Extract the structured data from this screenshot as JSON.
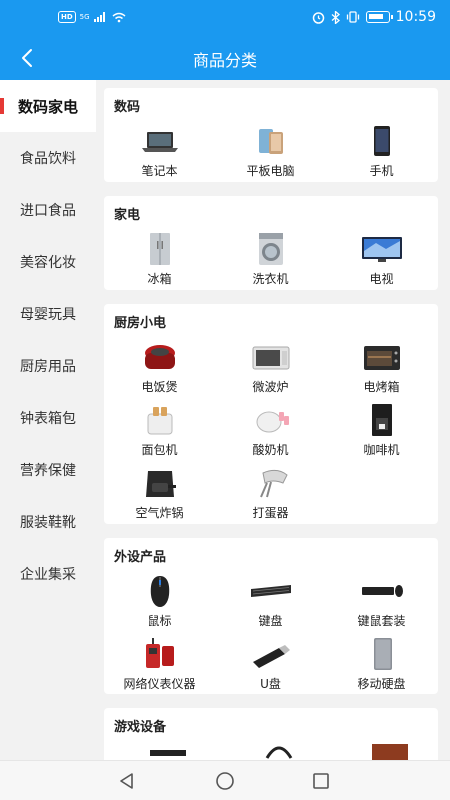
{
  "status": {
    "hd": "HD",
    "net": "5G",
    "time": "10:59",
    "battery": 0.85
  },
  "header": {
    "title": "商品分类"
  },
  "sidebar": {
    "items": [
      {
        "label": "数码家电",
        "active": true
      },
      {
        "label": "食品饮料"
      },
      {
        "label": "进口食品"
      },
      {
        "label": "美容化妆"
      },
      {
        "label": "母婴玩具"
      },
      {
        "label": "厨房用品"
      },
      {
        "label": "钟表箱包"
      },
      {
        "label": "营养保健"
      },
      {
        "label": "服装鞋靴"
      },
      {
        "label": "企业集采"
      }
    ]
  },
  "sections": [
    {
      "title": "数码",
      "items": [
        {
          "label": "笔记本",
          "icon": "laptop-icon"
        },
        {
          "label": "平板电脑",
          "icon": "tablet-icon"
        },
        {
          "label": "手机",
          "icon": "phone-icon"
        }
      ]
    },
    {
      "title": "家电",
      "items": [
        {
          "label": "冰箱",
          "icon": "fridge-icon"
        },
        {
          "label": "洗衣机",
          "icon": "washer-icon"
        },
        {
          "label": "电视",
          "icon": "tv-icon"
        }
      ]
    },
    {
      "title": "厨房小电",
      "items": [
        {
          "label": "电饭煲",
          "icon": "rice-cooker-icon"
        },
        {
          "label": "微波炉",
          "icon": "microwave-icon"
        },
        {
          "label": "电烤箱",
          "icon": "oven-icon"
        },
        {
          "label": "面包机",
          "icon": "toaster-icon"
        },
        {
          "label": "酸奶机",
          "icon": "yogurt-maker-icon"
        },
        {
          "label": "咖啡机",
          "icon": "coffee-machine-icon"
        },
        {
          "label": "空气炸锅",
          "icon": "air-fryer-icon"
        },
        {
          "label": "打蛋器",
          "icon": "mixer-icon"
        }
      ]
    },
    {
      "title": "外设产品",
      "items": [
        {
          "label": "鼠标",
          "icon": "mouse-icon"
        },
        {
          "label": "键盘",
          "icon": "keyboard-icon"
        },
        {
          "label": "键鼠套装",
          "icon": "keyboard-mouse-set-icon"
        },
        {
          "label": "网络仪表仪器",
          "icon": "network-tester-icon"
        },
        {
          "label": "U盘",
          "icon": "usb-drive-icon"
        },
        {
          "label": "移动硬盘",
          "icon": "hard-drive-icon"
        }
      ]
    },
    {
      "title": "游戏设备",
      "items": []
    }
  ],
  "colors": {
    "primary": "#1a99f0",
    "active_marker": "#e53935"
  }
}
